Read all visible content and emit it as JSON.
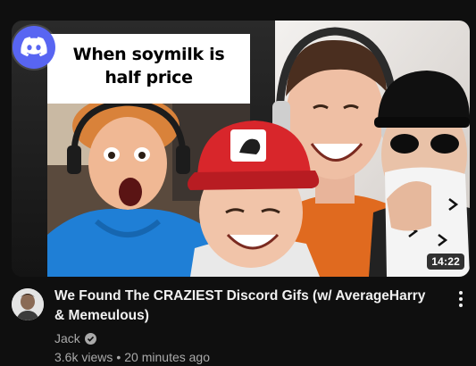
{
  "video": {
    "duration": "14:22",
    "thumbnail_caption": "When soymilk is half price",
    "title": "We Found The CRAZIEST Discord Gifs (w/ AverageHarry & Memeulous)",
    "channel": "Jack",
    "views": "3.6k views",
    "separator": "•",
    "published": "20 minutes ago"
  },
  "icons": {
    "badge": "discord-logo-icon",
    "verified": "check-circle-icon",
    "menu": "more-vert-icon"
  },
  "colors": {
    "background": "#0f0f0f",
    "discord_blurple": "#5865f2",
    "title_text": "#f1f1f1",
    "secondary_text": "#aaaaaa"
  }
}
